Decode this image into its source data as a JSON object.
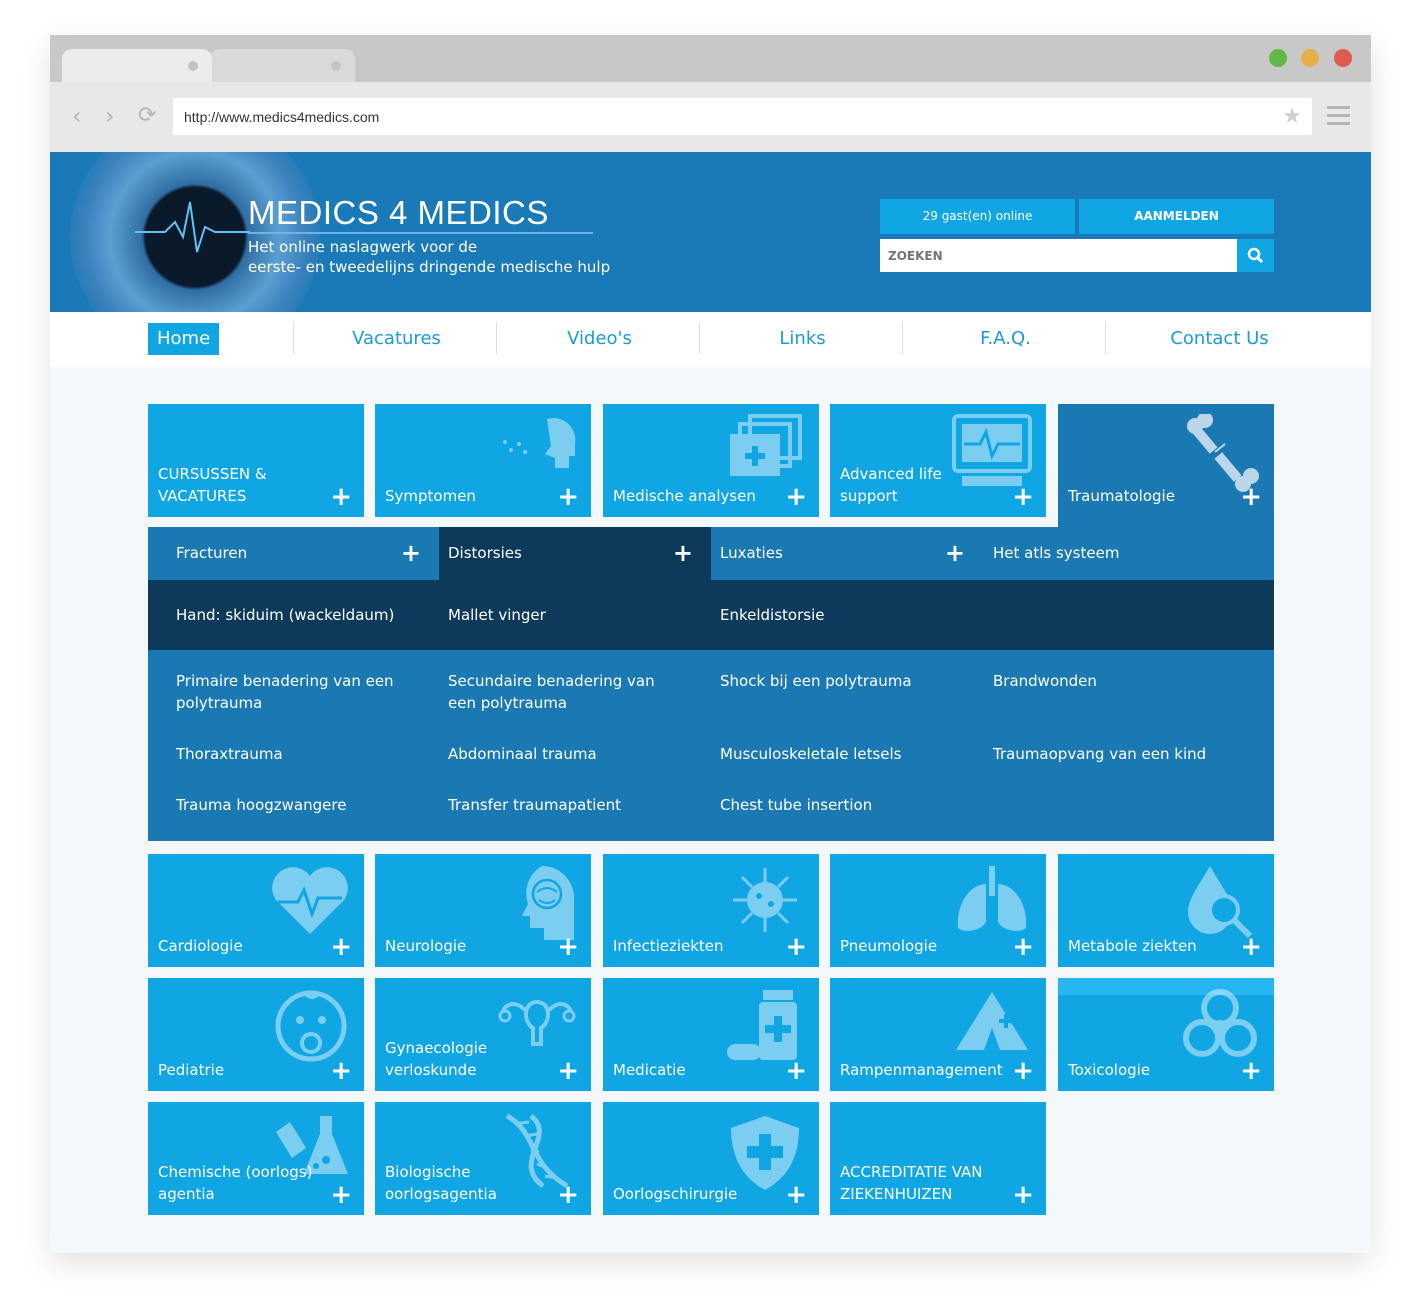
{
  "browser": {
    "url": "http://www.medics4medics.com"
  },
  "header": {
    "logo_title": "MEDICS 4 MEDICS",
    "logo_sub_line1": "Het online naslagwerk voor de",
    "logo_sub_line2": "eerste- en tweedelijns dringende medische hulp",
    "online": "29 gast(en) online",
    "login": "AANMELDEN",
    "search_placeholder": "ZOEKEN"
  },
  "nav": {
    "items": [
      "Home",
      "Vacatures",
      "Video's",
      "Links",
      "F.A.Q.",
      "Contact Us"
    ],
    "active": "Home"
  },
  "tiles_top": [
    {
      "label": "CURSUSSEN & VACATURES",
      "icon": "none"
    },
    {
      "label": "Symptomen",
      "icon": "cough-head-icon"
    },
    {
      "label": "Medische analysen",
      "icon": "medical-folders-icon"
    },
    {
      "label": "Advanced life support",
      "icon": "ecg-monitor-icon"
    },
    {
      "label": "Traumatologie",
      "icon": "broken-bone-icon"
    }
  ],
  "submenu": {
    "tabs": [
      "Fracturen",
      "Distorsies",
      "Luxaties",
      "Het atls systeem"
    ],
    "active_tab": "Distorsies",
    "active_links": [
      "Hand: skiduim (wackeldaum)",
      "Mallet vinger",
      "Enkeldistorsie"
    ],
    "links": [
      "Primaire benadering van een polytrauma",
      "Secundaire benadering van een polytrauma",
      "Shock bij een polytrauma",
      "Brandwonden",
      "Thoraxtrauma",
      "Abdominaal trauma",
      "Musculoskeletale letsels",
      "Traumaopvang van een kind",
      "Trauma hoogzwangere",
      "Transfer traumapatient",
      "Chest tube insertion"
    ]
  },
  "tiles_bottom": [
    {
      "label": "Cardiologie",
      "icon": "heart-icon"
    },
    {
      "label": "Neurologie",
      "icon": "brain-head-icon"
    },
    {
      "label": "Infectieziekten",
      "icon": "virus-icon"
    },
    {
      "label": "Pneumologie",
      "icon": "lungs-icon"
    },
    {
      "label": "Metabole ziekten",
      "icon": "drop-magnifier-icon"
    },
    {
      "label": "Pediatrie",
      "icon": "baby-icon"
    },
    {
      "label": "Gynaecologie verloskunde",
      "icon": "uterus-icon"
    },
    {
      "label": "Medicatie",
      "icon": "pill-bottle-icon"
    },
    {
      "label": "Rampenmanagement",
      "icon": "tent-icon"
    },
    {
      "label": "Toxicologie",
      "icon": "biohazard-icon"
    },
    {
      "label": "Chemische (oorlogs) agentia",
      "icon": "flask-icon"
    },
    {
      "label": "Biologische oorlogsagentia",
      "icon": "dna-icon"
    },
    {
      "label": "Oorlogschirurgie",
      "icon": "shield-cross-icon"
    },
    {
      "label": "ACCREDITATIE VAN ZIEKENHUIZEN",
      "icon": "none"
    }
  ],
  "plus_symbol": "+"
}
